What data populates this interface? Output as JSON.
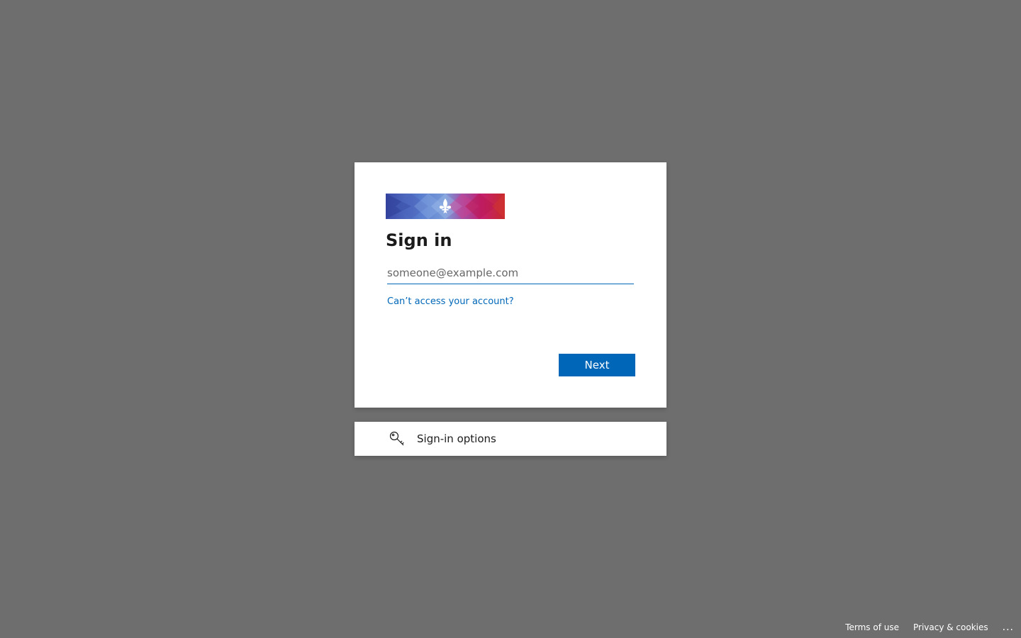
{
  "signin": {
    "title": "Sign in",
    "email_placeholder": "someone@example.com",
    "email_value": "",
    "help_link": "Can’t access your account?",
    "next_label": "Next"
  },
  "options": {
    "label": "Sign-in options",
    "icon": "key-icon"
  },
  "footer": {
    "terms": "Terms of use",
    "privacy": "Privacy & cookies",
    "more": "..."
  },
  "colors": {
    "background": "#6e6e6e",
    "card": "#ffffff",
    "accent": "#0067b8",
    "text": "#1b1b1b",
    "banner_blue": "#3b4aa8",
    "banner_magenta": "#c41f72",
    "banner_red": "#c72a2a"
  },
  "logo": {
    "icon": "fleur-de-lis-icon"
  }
}
